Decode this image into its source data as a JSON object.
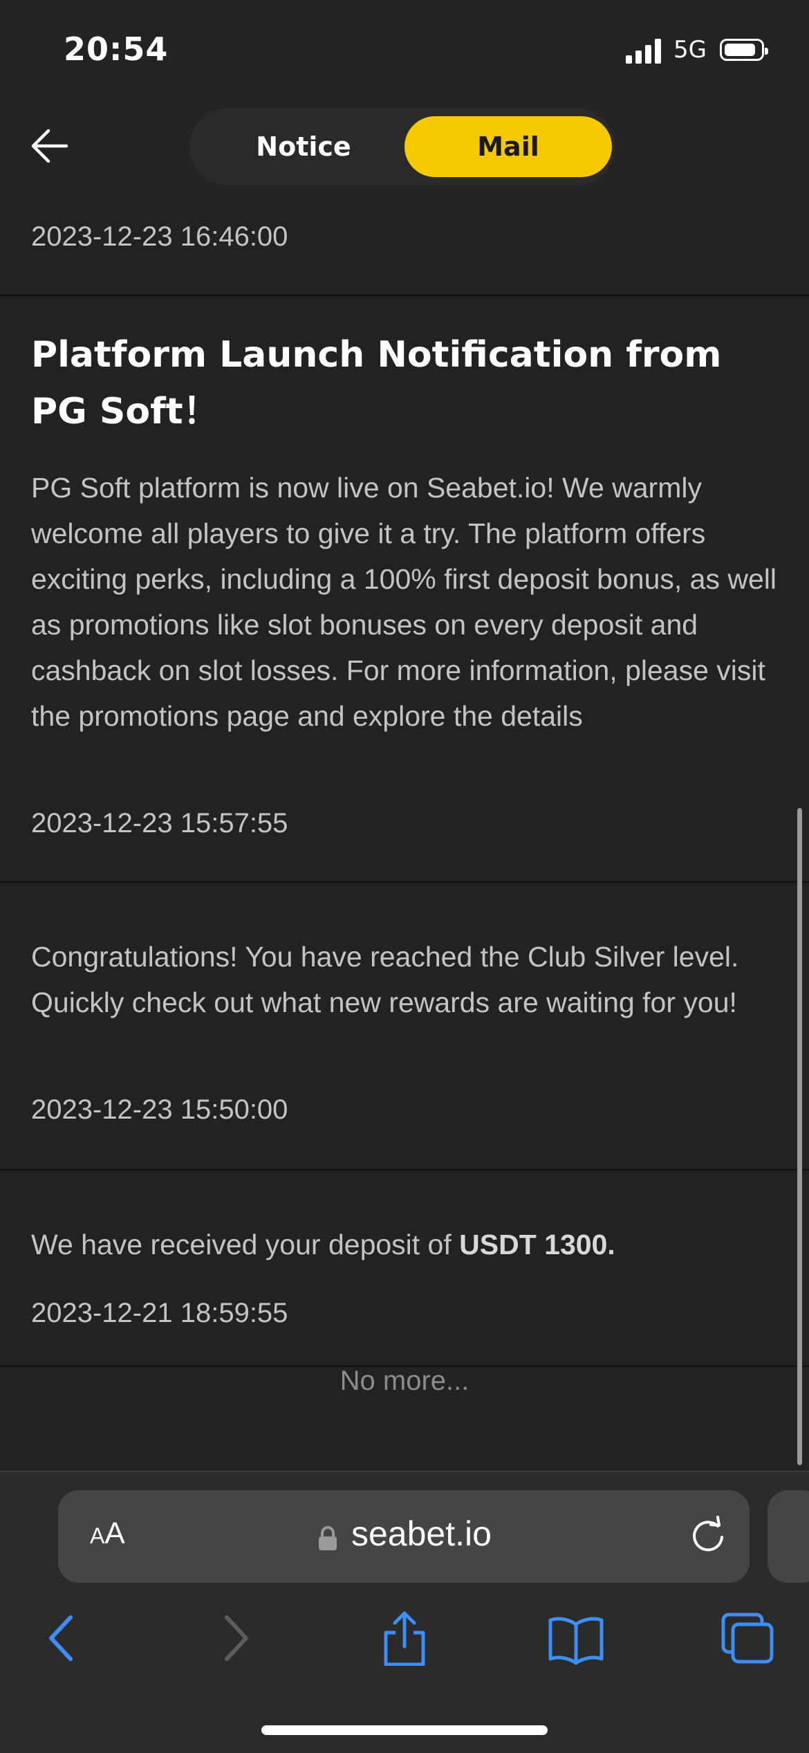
{
  "status_bar": {
    "time": "20:54",
    "network": "5G"
  },
  "header": {
    "tabs": [
      {
        "label": "Notice",
        "active": false
      },
      {
        "label": "Mail",
        "active": true
      }
    ],
    "accent_color": "#f5c800"
  },
  "messages": [
    {
      "date": "2023-12-23 16:46:00"
    },
    {
      "title": "Platform Launch Notification from PG Soft！",
      "body": "PG Soft platform is now live on Seabet.io! We warmly welcome all players to give it a try. The platform offers exciting perks, including a 100% first deposit bonus, as well as promotions like slot bonuses on every deposit and cashback on slot losses. For more information, please visit the promotions page and explore the details",
      "date": "2023-12-23 15:57:55"
    },
    {
      "body": "Congratulations! You have reached the Club Silver level. Quickly check out what new rewards are waiting for you!",
      "date": "2023-12-23 15:50:00"
    },
    {
      "body_prefix": "We have received your deposit of ",
      "body_bold": "USDT 1300.",
      "date": "2023-12-21 18:59:55"
    }
  ],
  "footer_text": "No more...",
  "browser": {
    "aa_label_small": "A",
    "aa_label_large": "A",
    "url": "seabet.io"
  },
  "icons": [
    "back-arrow-icon",
    "lock-icon",
    "reload-icon",
    "browser-back-icon",
    "browser-forward-icon",
    "share-icon",
    "bookmarks-icon",
    "tabs-icon"
  ]
}
